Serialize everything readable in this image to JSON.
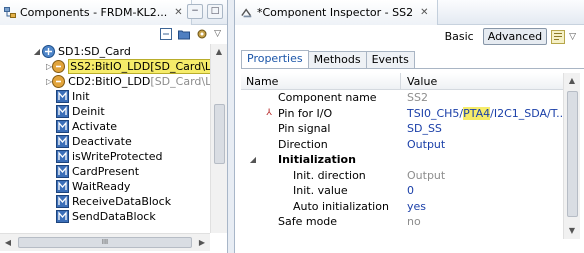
{
  "left_view": {
    "tab_title": "Components - FRDM-KL2...",
    "tab_close": "✕",
    "minimize": "−",
    "maximize": "□",
    "toolbar_arrow": "▽",
    "tree": {
      "root": {
        "expander": "◢",
        "label": "SD1:SD_Card"
      },
      "items": [
        {
          "expander": "▷",
          "main": "SS2:BitIO_LDD",
          "suffix": "[SD_Card\\LDD",
          "highlighted": true
        },
        {
          "expander": "▷",
          "main": "CD2:BitIO_LDD",
          "suffix": "[SD_Card\\LD",
          "highlighted": false
        },
        {
          "label": "Init"
        },
        {
          "label": "Deinit"
        },
        {
          "label": "Activate"
        },
        {
          "label": "Deactivate"
        },
        {
          "label": "isWriteProtected"
        },
        {
          "label": "CardPresent"
        },
        {
          "label": "WaitReady"
        },
        {
          "label": "ReceiveDataBlock"
        },
        {
          "label": "SendDataBlock"
        }
      ]
    },
    "scroll_grip": "III",
    "scroll_left": "◀",
    "scroll_right": "▶",
    "scroll_up": "▲"
  },
  "right_view": {
    "tab_title": "*Component Inspector - SS2",
    "tab_close": "✕",
    "modes": {
      "basic": "Basic",
      "advanced": "Advanced",
      "active": "Advanced"
    },
    "menu_arrow": "▽",
    "subtabs": [
      {
        "label": "Properties",
        "active": true
      },
      {
        "label": "Methods",
        "active": false
      },
      {
        "label": "Events",
        "active": false
      }
    ],
    "columns": {
      "name": "Name",
      "value": "Value"
    },
    "rows": [
      {
        "name": "Component name",
        "value": "SS2",
        "value_style": "muted"
      },
      {
        "name": "Pin for I/O",
        "value_pre": "TSI0_CH5/",
        "value_mark": "PTA4",
        "value_post": "/I2C1_SDA/T...",
        "error_icon": "⅄"
      },
      {
        "name": "Pin signal",
        "value": "SD_SS",
        "value_style": "blue"
      },
      {
        "name": "Direction",
        "value": "Output",
        "value_style": "blue"
      },
      {
        "name": "Initialization",
        "value": "",
        "group": true,
        "expander": "◢"
      },
      {
        "name": "Init. direction",
        "value": "Output",
        "value_style": "muted",
        "indent": 2
      },
      {
        "name": "Init. value",
        "value": "0",
        "value_style": "blue",
        "indent": 2
      },
      {
        "name": "Auto initialization",
        "value": "yes",
        "value_style": "blue",
        "indent": 2
      },
      {
        "name": "Safe mode",
        "value": "no",
        "value_style": "muted",
        "indent": 1
      }
    ],
    "scroll_up": "▲",
    "scroll_down": "▼"
  }
}
